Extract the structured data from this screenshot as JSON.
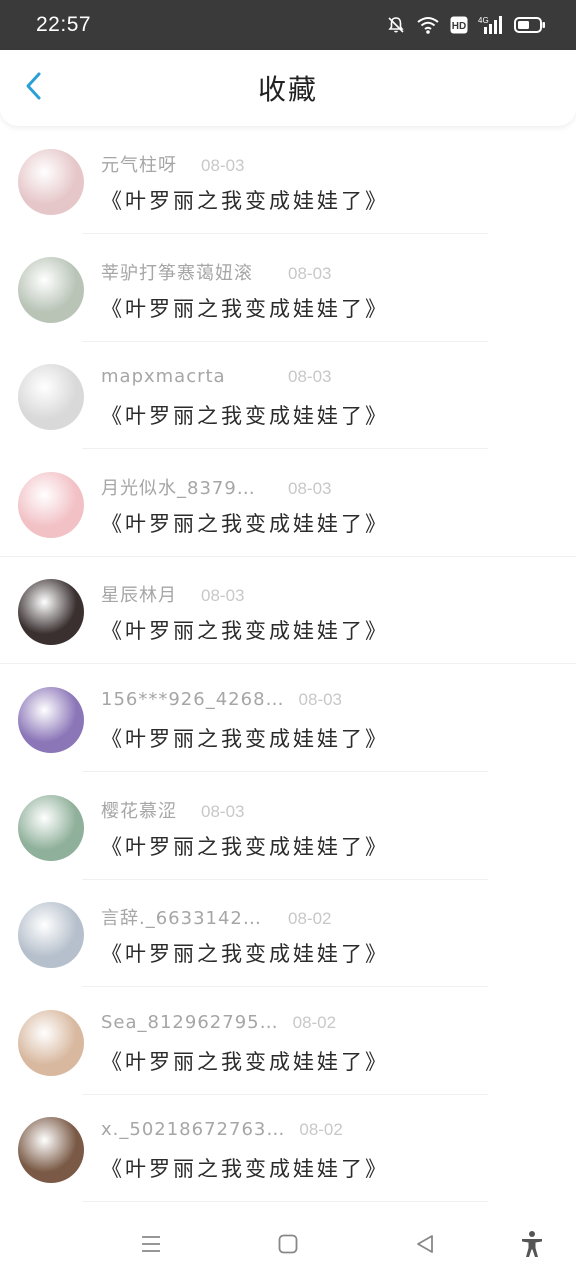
{
  "status_bar": {
    "time": "22:57",
    "icons": [
      "mute-bell-icon",
      "wifi-icon",
      "hd-icon",
      "signal-4g-icon",
      "battery-icon"
    ],
    "hd_label": "HD",
    "network_label": "4G"
  },
  "header": {
    "title": "收藏",
    "back_icon": "chevron-left-icon",
    "accent_color": "#2a9fd8"
  },
  "items": [
    {
      "user": "元气柱呀",
      "date": "08-03",
      "title": "《叶罗丽之我变成娃娃了》",
      "avatar_color": "#e6c7c9"
    },
    {
      "user": "莘驴打筝㥶蔼妞滚",
      "date": "08-03",
      "title": "《叶罗丽之我变成娃娃了》",
      "avatar_color": "#b9c4b7"
    },
    {
      "user": "mapxmacrta",
      "date": "08-03",
      "title": "《叶罗丽之我变成娃娃了》",
      "avatar_color": "#d9d9d9"
    },
    {
      "user": "月光似水_8379…",
      "date": "08-03",
      "title": "《叶罗丽之我变成娃娃了》",
      "avatar_color": "#f2c1c6"
    },
    {
      "user": "星辰林月",
      "date": "08-03",
      "title": "《叶罗丽之我变成娃娃了》",
      "avatar_color": "#3a3030"
    },
    {
      "user": "156***926_4268…",
      "date": "08-03",
      "title": "《叶罗丽之我变成娃娃了》",
      "avatar_color": "#8b76b8"
    },
    {
      "user": "樱花慕涩",
      "date": "08-03",
      "title": "《叶罗丽之我变成娃娃了》",
      "avatar_color": "#8fb09a"
    },
    {
      "user": "言辞._6633142…",
      "date": "08-02",
      "title": "《叶罗丽之我变成娃娃了》",
      "avatar_color": "#b6c0cc"
    },
    {
      "user": "Sea_812962795…",
      "date": "08-02",
      "title": "《叶罗丽之我变成娃娃了》",
      "avatar_color": "#d8b89f"
    },
    {
      "user": "x._50218672763…",
      "date": "08-02",
      "title": "《叶罗丽之我变成娃娃了》",
      "avatar_color": "#7a5a46"
    }
  ],
  "nav_bar": {
    "icons": [
      "menu-icon",
      "home-square-icon",
      "back-triangle-icon",
      "accessibility-icon"
    ]
  }
}
